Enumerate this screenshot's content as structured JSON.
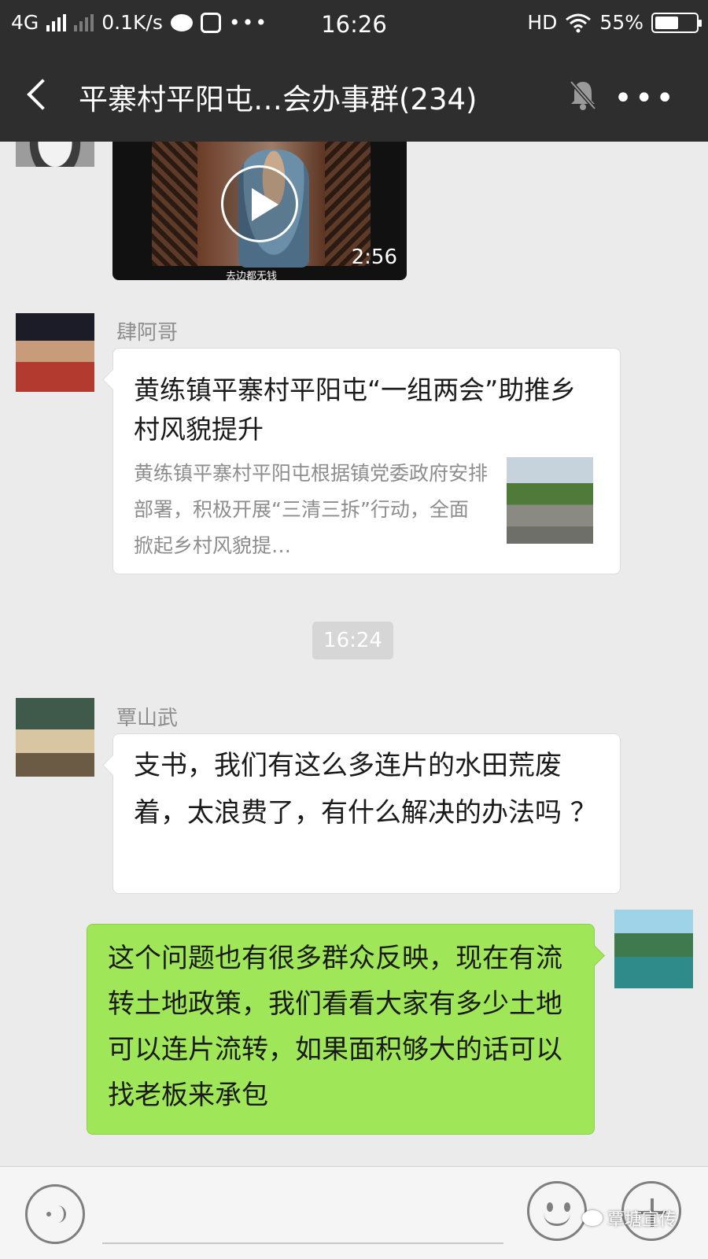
{
  "status_bar": {
    "network": "4G",
    "speed": "0.1K/s",
    "more": "•••",
    "time": "16:26",
    "hd": "HD",
    "battery_percent": "55%",
    "battery_level": 0.55
  },
  "header": {
    "title": "平寨村平阳屯…会办事群(234)"
  },
  "messages": {
    "video": {
      "caption": "去边都无钱",
      "duration": "2:56"
    },
    "link": {
      "sender": "肆阿哥",
      "title": "黄练镇平寨村平阳屯“一组两会”助推乡村风貌提升",
      "description": "黄练镇平寨村平阳屯根据镇党委政府安排部署，积极开展“三清三拆”行动，全面掀起乡村风貌提…"
    },
    "timestamp": "16:24",
    "question": {
      "sender": "覃山武",
      "text": "支书，我们有这么多连片的水田荒废着，太浪费了，有什么解决的办法吗 ？"
    },
    "reply": {
      "text": "  这个问题也有很多群众反映，现在有流转土地政策，我们看看大家有多少土地可以连片流转，如果面积够大的话可以找老板来承包"
    }
  },
  "watermark": {
    "label": "覃塘宣传"
  },
  "colors": {
    "header_bg": "#2e2e2e",
    "chat_bg": "#ebebeb",
    "self_bubble": "#9fe658"
  }
}
